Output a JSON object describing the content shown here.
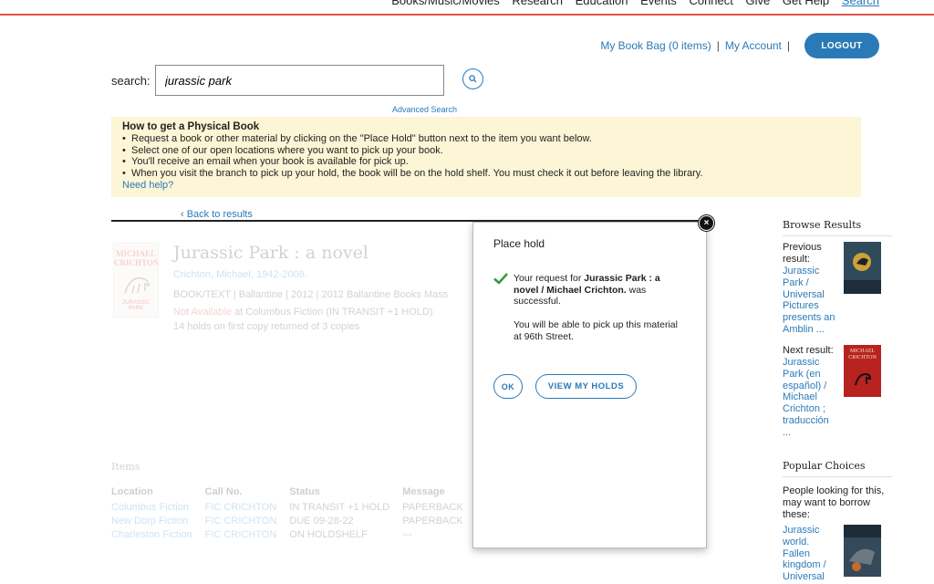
{
  "topnav": {
    "links": [
      "Books/Music/Movies",
      "Research",
      "Education",
      "Events",
      "Connect",
      "Give",
      "Get Help"
    ],
    "search_link": "Search"
  },
  "account": {
    "bookbag": "My Book Bag (0 items)",
    "sep": "|",
    "myaccount": "My Account",
    "logout": "LOGOUT"
  },
  "search": {
    "label": "search:",
    "value": "jurassic park",
    "advanced": "Advanced Search"
  },
  "info": {
    "heading": "How to get a Physical Book",
    "bullets": [
      "Request a book or other material by clicking on the \"Place Hold\" button next to the item you want below.",
      "Select one of our open locations where you want to pick up your book.",
      "You'll receive an email when your book is available for pick up.",
      "When you visit the branch to pick up your hold, the book will be on the hold shelf. You must check it out before leaving the library."
    ],
    "help": "Need help?"
  },
  "back_link": "‹  Back to results",
  "record": {
    "cover_author": "MICHAEL CRICHTON",
    "cover_title": "JURASSIC PARK",
    "title": "Jurassic Park : a novel",
    "author": "Crichton, Michael, 1942-2008.",
    "format_line": "BOOK/TEXT  |  Ballantine  |  2012  |  2012 Ballantine Books Mass",
    "avail_status": "Not Available",
    "avail_rest": " at Columbus Fiction (IN TRANSIT +1 HOLD)",
    "holds": "14 holds on first copy returned of 3 copies"
  },
  "items": {
    "heading": "Items",
    "columns": [
      "Location",
      "Call No.",
      "Status",
      "Message"
    ],
    "rows": [
      [
        "Columbus Fiction",
        "FIC CRICHTON",
        "IN TRANSIT +1 HOLD",
        "PAPERBACK"
      ],
      [
        "New Dorp Fiction",
        "FIC CRICHTON",
        "DUE 09-28-22",
        "PAPERBACK"
      ],
      [
        "Charleston Fiction",
        "FIC CRICHTON",
        "ON HOLDSHELF",
        "---"
      ]
    ]
  },
  "modal": {
    "title": "Place hold",
    "msg_pre": "Your request for ",
    "msg_bold": "Jurassic Park : a novel / Michael Crichton.",
    "msg_post": " was successful.",
    "msg2": "You will be able to pick up this material at 96th Street.",
    "ok": "OK",
    "view_holds": "VIEW MY HOLDS",
    "close": "×"
  },
  "sidebar": {
    "browse_heading": "Browse Results",
    "prev_label": "Previous result:",
    "prev_link": "Jurassic Park / Universal Pictures presents an Amblin ...",
    "next_label": "Next result:",
    "next_link": "Jurassic Park (en español) / Michael Crichton ; traducción ...",
    "next_thumb_text": "MICHAEL CRICHTON",
    "popular_heading": "Popular Choices",
    "popular_label": "People looking for this, may want to borrow these:",
    "popular_link": "Jurassic world. Fallen kingdom / Universal"
  },
  "colors": {
    "accent": "#2a7ab8",
    "nav_rule": "#e0534a",
    "info_bg": "#fcf5d6",
    "success": "#3a9a3a",
    "unavailable": "#c0392b"
  }
}
